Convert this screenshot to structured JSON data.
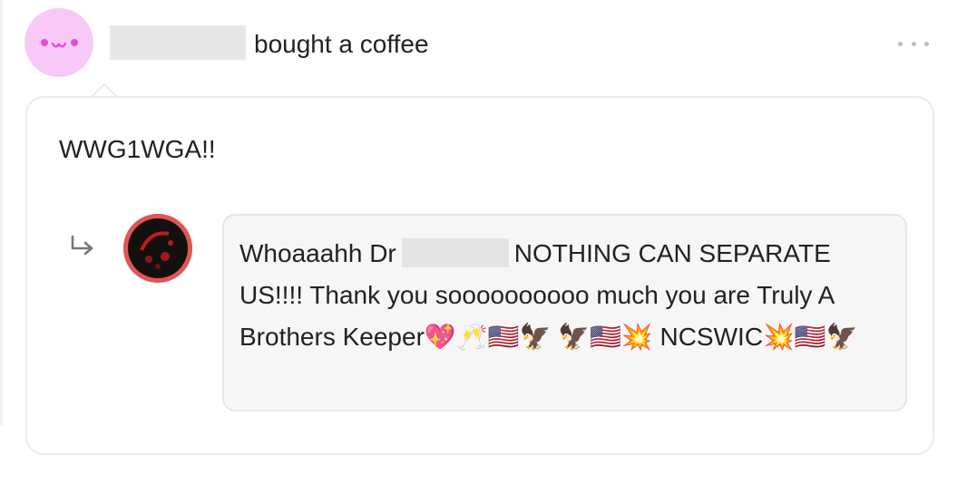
{
  "header": {
    "action_text": "bought a coffee"
  },
  "post": {
    "message": "WWG1WGA!!"
  },
  "reply": {
    "text_before_name": "Whoaaahh Dr",
    "text_after_name": "NOTHING CAN SEPARATE US!!!! Thank you soooooooooo much you are Truly A Brothers Keeper💖🥂🇺🇸🦅 🦅🇺🇸💥 NCSWIC💥🇺🇸🦅"
  },
  "icons": {
    "supporter_avatar": "smiley-face-icon",
    "more_options": "ellipsis-icon",
    "reply_arrow": "reply-arrow-icon",
    "creator_avatar": "creator-avatar-image"
  },
  "colors": {
    "supporter_avatar_bg": "#f8c9f7",
    "supporter_avatar_face": "#e64ad9",
    "creator_avatar_ring": "#e25555",
    "bubble_bg": "#f6f6f6",
    "card_border": "#ececec"
  }
}
